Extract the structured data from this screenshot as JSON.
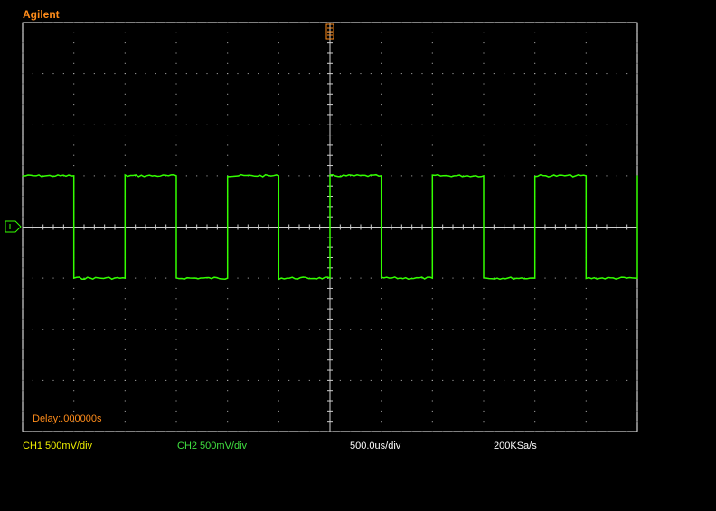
{
  "brand": "Agilent",
  "delay_label": "Delay:.000000s",
  "status_bar": {
    "ch1_scale": "CH1 500mV/div",
    "ch2_scale": "CH2 500mV/div",
    "timebase": "500.0us/div",
    "sample_rate": "200KSa/s"
  },
  "markers": {
    "trigger_position_icon": "trigger-position-icon",
    "ground_marker_icon": "ch-ground-marker-icon"
  },
  "waveform": {
    "color": "#33ff00",
    "shape": "square",
    "high_div": 1,
    "low_div": -1,
    "cycles": 6,
    "first_fall_time_div": 1.0
  },
  "colors": {
    "background": "#000000",
    "border": "#ffffff",
    "grid": "#cfcfcf",
    "accent": "#ff8c1a"
  }
}
